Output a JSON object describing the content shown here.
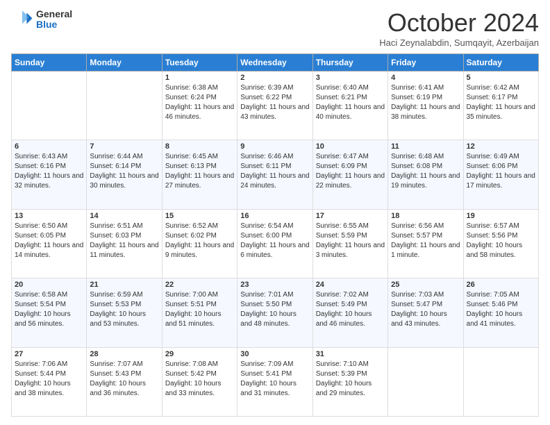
{
  "header": {
    "logo": {
      "general": "General",
      "blue": "Blue"
    },
    "title": "October 2024",
    "subtitle": "Haci Zeynalabdin, Sumqayit, Azerbaijan"
  },
  "days_of_week": [
    "Sunday",
    "Monday",
    "Tuesday",
    "Wednesday",
    "Thursday",
    "Friday",
    "Saturday"
  ],
  "weeks": [
    [
      {
        "day": "",
        "info": ""
      },
      {
        "day": "",
        "info": ""
      },
      {
        "day": "1",
        "info": "Sunrise: 6:38 AM\nSunset: 6:24 PM\nDaylight: 11 hours and 46 minutes."
      },
      {
        "day": "2",
        "info": "Sunrise: 6:39 AM\nSunset: 6:22 PM\nDaylight: 11 hours and 43 minutes."
      },
      {
        "day": "3",
        "info": "Sunrise: 6:40 AM\nSunset: 6:21 PM\nDaylight: 11 hours and 40 minutes."
      },
      {
        "day": "4",
        "info": "Sunrise: 6:41 AM\nSunset: 6:19 PM\nDaylight: 11 hours and 38 minutes."
      },
      {
        "day": "5",
        "info": "Sunrise: 6:42 AM\nSunset: 6:17 PM\nDaylight: 11 hours and 35 minutes."
      }
    ],
    [
      {
        "day": "6",
        "info": "Sunrise: 6:43 AM\nSunset: 6:16 PM\nDaylight: 11 hours and 32 minutes."
      },
      {
        "day": "7",
        "info": "Sunrise: 6:44 AM\nSunset: 6:14 PM\nDaylight: 11 hours and 30 minutes."
      },
      {
        "day": "8",
        "info": "Sunrise: 6:45 AM\nSunset: 6:13 PM\nDaylight: 11 hours and 27 minutes."
      },
      {
        "day": "9",
        "info": "Sunrise: 6:46 AM\nSunset: 6:11 PM\nDaylight: 11 hours and 24 minutes."
      },
      {
        "day": "10",
        "info": "Sunrise: 6:47 AM\nSunset: 6:09 PM\nDaylight: 11 hours and 22 minutes."
      },
      {
        "day": "11",
        "info": "Sunrise: 6:48 AM\nSunset: 6:08 PM\nDaylight: 11 hours and 19 minutes."
      },
      {
        "day": "12",
        "info": "Sunrise: 6:49 AM\nSunset: 6:06 PM\nDaylight: 11 hours and 17 minutes."
      }
    ],
    [
      {
        "day": "13",
        "info": "Sunrise: 6:50 AM\nSunset: 6:05 PM\nDaylight: 11 hours and 14 minutes."
      },
      {
        "day": "14",
        "info": "Sunrise: 6:51 AM\nSunset: 6:03 PM\nDaylight: 11 hours and 11 minutes."
      },
      {
        "day": "15",
        "info": "Sunrise: 6:52 AM\nSunset: 6:02 PM\nDaylight: 11 hours and 9 minutes."
      },
      {
        "day": "16",
        "info": "Sunrise: 6:54 AM\nSunset: 6:00 PM\nDaylight: 11 hours and 6 minutes."
      },
      {
        "day": "17",
        "info": "Sunrise: 6:55 AM\nSunset: 5:59 PM\nDaylight: 11 hours and 3 minutes."
      },
      {
        "day": "18",
        "info": "Sunrise: 6:56 AM\nSunset: 5:57 PM\nDaylight: 11 hours and 1 minute."
      },
      {
        "day": "19",
        "info": "Sunrise: 6:57 AM\nSunset: 5:56 PM\nDaylight: 10 hours and 58 minutes."
      }
    ],
    [
      {
        "day": "20",
        "info": "Sunrise: 6:58 AM\nSunset: 5:54 PM\nDaylight: 10 hours and 56 minutes."
      },
      {
        "day": "21",
        "info": "Sunrise: 6:59 AM\nSunset: 5:53 PM\nDaylight: 10 hours and 53 minutes."
      },
      {
        "day": "22",
        "info": "Sunrise: 7:00 AM\nSunset: 5:51 PM\nDaylight: 10 hours and 51 minutes."
      },
      {
        "day": "23",
        "info": "Sunrise: 7:01 AM\nSunset: 5:50 PM\nDaylight: 10 hours and 48 minutes."
      },
      {
        "day": "24",
        "info": "Sunrise: 7:02 AM\nSunset: 5:49 PM\nDaylight: 10 hours and 46 minutes."
      },
      {
        "day": "25",
        "info": "Sunrise: 7:03 AM\nSunset: 5:47 PM\nDaylight: 10 hours and 43 minutes."
      },
      {
        "day": "26",
        "info": "Sunrise: 7:05 AM\nSunset: 5:46 PM\nDaylight: 10 hours and 41 minutes."
      }
    ],
    [
      {
        "day": "27",
        "info": "Sunrise: 7:06 AM\nSunset: 5:44 PM\nDaylight: 10 hours and 38 minutes."
      },
      {
        "day": "28",
        "info": "Sunrise: 7:07 AM\nSunset: 5:43 PM\nDaylight: 10 hours and 36 minutes."
      },
      {
        "day": "29",
        "info": "Sunrise: 7:08 AM\nSunset: 5:42 PM\nDaylight: 10 hours and 33 minutes."
      },
      {
        "day": "30",
        "info": "Sunrise: 7:09 AM\nSunset: 5:41 PM\nDaylight: 10 hours and 31 minutes."
      },
      {
        "day": "31",
        "info": "Sunrise: 7:10 AM\nSunset: 5:39 PM\nDaylight: 10 hours and 29 minutes."
      },
      {
        "day": "",
        "info": ""
      },
      {
        "day": "",
        "info": ""
      }
    ]
  ]
}
